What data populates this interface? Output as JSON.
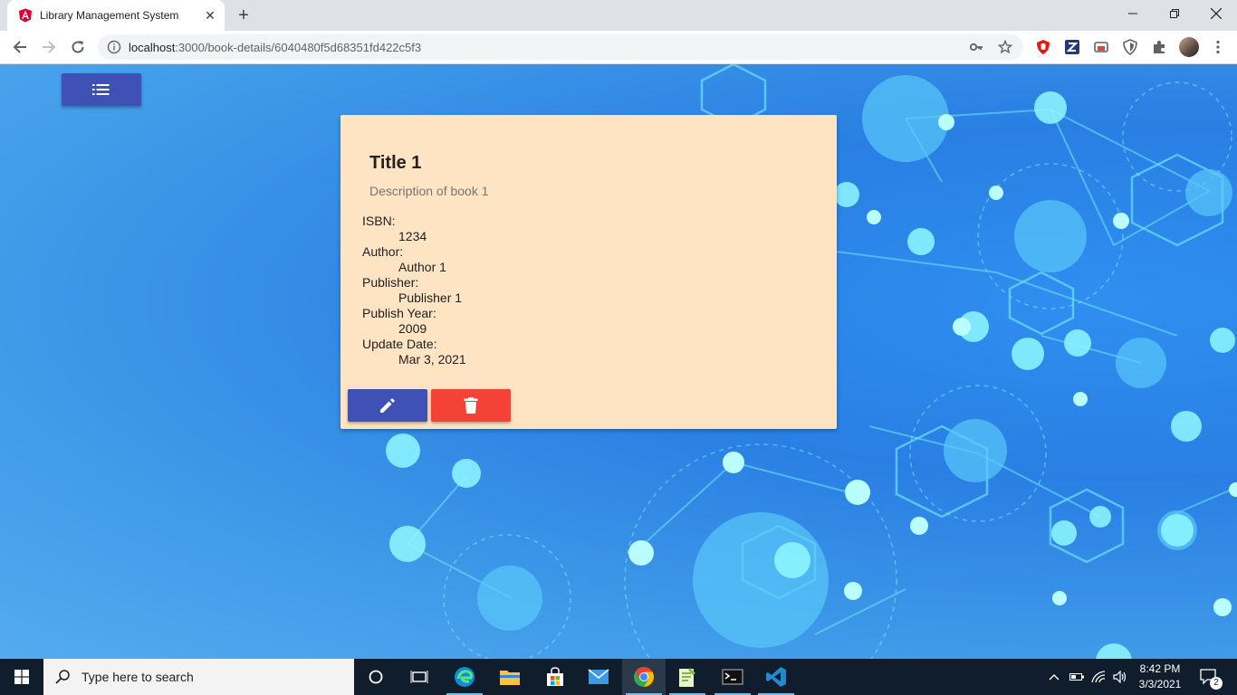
{
  "browser": {
    "tab_title": "Library Management System",
    "url_host": "localhost",
    "url_rest": ":3000/book-details/6040480f5d68351fd422c5f3"
  },
  "book": {
    "title": "Title 1",
    "description": "Description of book 1",
    "isbn_label": "ISBN:",
    "isbn": "1234",
    "author_label": "Author:",
    "author": "Author 1",
    "publisher_label": "Publisher:",
    "publisher": "Publisher 1",
    "year_label": "Publish Year:",
    "year": "2009",
    "update_label": "Update Date:",
    "update_date": "Mar 3, 2021"
  },
  "taskbar": {
    "search_placeholder": "Type here to search",
    "time": "8:42 PM",
    "date": "3/3/2021",
    "notification_count": "2"
  },
  "colors": {
    "menu_button": "#3f51b5",
    "edit_button": "#3f51b5",
    "delete_button": "#f44336",
    "card_background": "#ffe4c4"
  },
  "icons": [
    "angular-icon",
    "list-icon",
    "pencil-icon",
    "trash-icon",
    "windows-icon",
    "search-icon"
  ]
}
